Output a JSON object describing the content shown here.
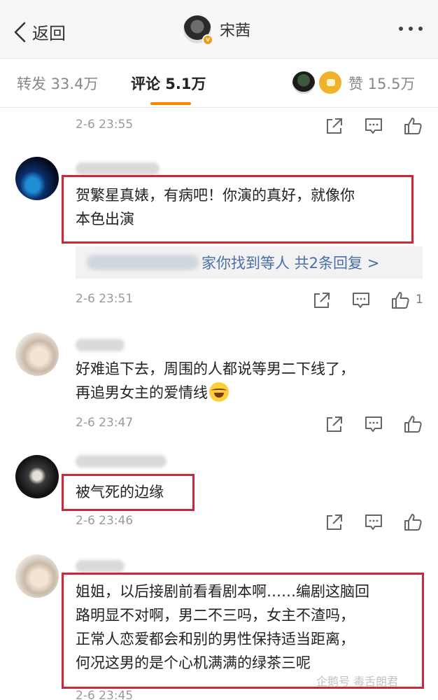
{
  "header": {
    "back_label": "返回",
    "title": "宋茜"
  },
  "tabs": {
    "repost": "转发 33.4万",
    "comments": "评论 5.1万",
    "likes": "赞 15.5万"
  },
  "comments": [
    {
      "time": "2-6 23:55",
      "like_count": ""
    },
    {
      "text_lines": [
        "贺繁星真婊，有病吧！你演的真好，就像你",
        "本色出演"
      ],
      "reply_summary": "等人  共2条回复 >",
      "reply_prefix": "家你找到",
      "time": "2-6 23:51",
      "like_count": "1"
    },
    {
      "text_lines": [
        "好难追下去，周围的人都说等男二下线了，",
        "再追男女主的爱情线"
      ],
      "time": "2-6 23:47",
      "like_count": ""
    },
    {
      "text_lines": [
        "被气死的边缘"
      ],
      "time": "2-6 23:46",
      "like_count": ""
    },
    {
      "text_lines": [
        "姐姐，以后接剧前看看剧本啊……编剧这脑回",
        "路明显不对啊，男二不三吗，女主不渣吗，",
        "正常人恋爱都会和别的男性保持适当距离，",
        "何况这男的是个心机满满的绿茶三呢"
      ],
      "time": "2-6 23:45",
      "like_count": ""
    }
  ],
  "watermark": "企鹅号 毒舌朗君",
  "colors": {
    "accent": "#ff8200",
    "highlight_box": "#c8283a",
    "link": "#4b6ea8",
    "verified_badge": "#f29a16"
  },
  "icons": [
    "back-chevron-icon",
    "more-icon",
    "repost-icon",
    "comment-icon",
    "like-icon"
  ]
}
